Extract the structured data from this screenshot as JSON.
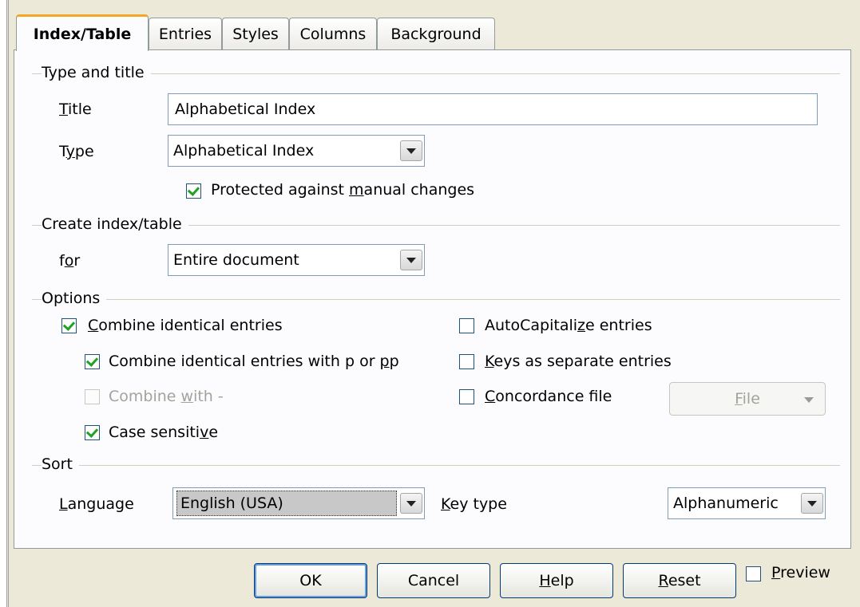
{
  "tabs": [
    "Index/Table",
    "Entries",
    "Styles",
    "Columns",
    "Background"
  ],
  "type_and_title": {
    "heading": "Type and title",
    "title_label_u": "T",
    "title_label_rest": "itle",
    "title_value": "Alphabetical Index",
    "type_label_pre": "T",
    "type_label_u": "y",
    "type_label_rest": "pe",
    "type_value": "Alphabetical Index",
    "protected_pre": "Protected against ",
    "protected_u": "m",
    "protected_rest": "anual changes",
    "protected_checked": true
  },
  "create": {
    "heading": "Create index/table",
    "for_pre": "f",
    "for_u": "o",
    "for_rest": "r",
    "for_value": "Entire document"
  },
  "options": {
    "heading": "Options",
    "combine_u": "C",
    "combine_rest": "ombine identical entries",
    "combine_pp_pre": "Combine identical entries with p or ",
    "combine_pp_u": "p",
    "combine_pp_rest": "p",
    "combine_with_pre": "Combine ",
    "combine_with_u": "w",
    "combine_with_rest": "ith -",
    "case_pre": "Case sensiti",
    "case_u": "v",
    "case_rest": "e",
    "autocap_pre": "AutoCapitali",
    "autocap_u": "z",
    "autocap_rest": "e entries",
    "keys_u": "K",
    "keys_rest": "eys as separate entries",
    "concord_u": "C",
    "concord_rest": "oncordance file",
    "file_u": "F",
    "file_rest": "ile"
  },
  "sort": {
    "heading": "Sort",
    "language_u": "L",
    "language_rest": "anguage",
    "language_value": "English (USA)",
    "keytype_u": "K",
    "keytype_rest": "ey type",
    "keytype_value": "Alphanumeric"
  },
  "buttons": {
    "ok": "OK",
    "cancel": "Cancel",
    "help_u": "H",
    "help_rest": "elp",
    "reset_u": "R",
    "reset_rest": "eset",
    "preview_u": "P",
    "preview_rest": "review"
  },
  "colors": {
    "accent": "#f5a623",
    "check": "#21a121",
    "field_border": "#7f9db9"
  }
}
